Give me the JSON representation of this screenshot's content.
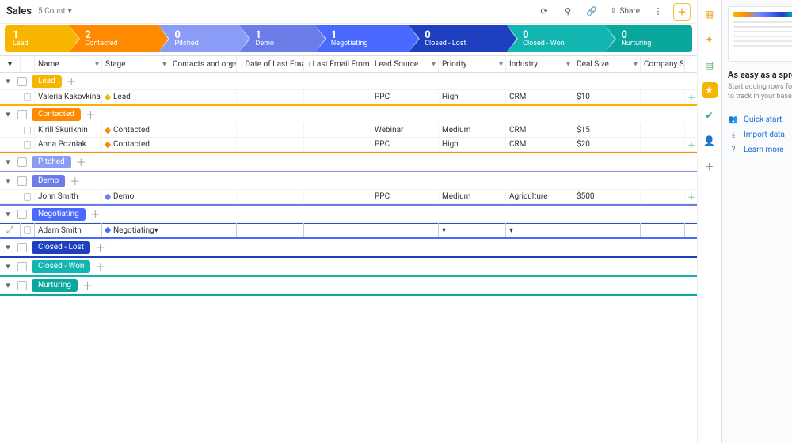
{
  "header": {
    "title": "Sales",
    "count_label": "5 Count",
    "share_label": "Share"
  },
  "funnel": [
    {
      "count": "1",
      "label": "Lead",
      "color": "#f7b500"
    },
    {
      "count": "2",
      "label": "Contacted",
      "color": "#ff8a00"
    },
    {
      "count": "0",
      "label": "Pitched",
      "color": "#8b9cf7"
    },
    {
      "count": "1",
      "label": "Demo",
      "color": "#6b7de8"
    },
    {
      "count": "1",
      "label": "Negotiating",
      "color": "#4a69ff"
    },
    {
      "count": "0",
      "label": "Closed - Lost",
      "color": "#1e3fbf"
    },
    {
      "count": "0",
      "label": "Closed - Won",
      "color": "#13b5b1"
    },
    {
      "count": "0",
      "label": "Nurturing",
      "color": "#0aa79e"
    }
  ],
  "columns": {
    "name": "Name",
    "stage": "Stage",
    "contacts": "Contacts and organizations",
    "date_email": "Date of Last Email",
    "from_email": "Last Email From",
    "lead_source": "Lead Source",
    "priority": "Priority",
    "industry": "Industry",
    "deal_size": "Deal Size",
    "company": "Company Size"
  },
  "groups": [
    {
      "id": "lead",
      "label": "Lead",
      "pill_color": "#f7b500",
      "accent": "#f7b500",
      "rows": [
        {
          "name": "Valeria Kakovkina",
          "stage": "Lead",
          "stage_color": "#f7b500",
          "source": "PPC",
          "priority": "High",
          "industry": "CRM",
          "deal": "$10"
        }
      ]
    },
    {
      "id": "contacted",
      "label": "Contacted",
      "pill_color": "#ff8a00",
      "accent": "#ff8a00",
      "rows": [
        {
          "name": "Kirill Skurikhin",
          "stage": "Contacted",
          "stage_color": "#ff8a00",
          "source": "Webinar",
          "priority": "Medium",
          "industry": "CRM",
          "deal": "$15"
        },
        {
          "name": "Anna Pozniak",
          "stage": "Contacted",
          "stage_color": "#ff8a00",
          "source": "PPC",
          "priority": "High",
          "industry": "CRM",
          "deal": "$20"
        }
      ]
    },
    {
      "id": "pitched",
      "label": "Pitched",
      "pill_color": "#8b9cf7",
      "accent": "#8b9cf7",
      "rows": []
    },
    {
      "id": "demo",
      "label": "Demo",
      "pill_color": "#6b7de8",
      "accent": "#6b7de8",
      "rows": [
        {
          "name": "John Smith",
          "stage": "Demo",
          "stage_color": "#6b7de8",
          "source": "PPC",
          "priority": "Medium",
          "industry": "Agriculture",
          "deal": "$500"
        }
      ]
    },
    {
      "id": "negotiating",
      "label": "Negotiating",
      "pill_color": "#4a69ff",
      "accent": "#4a69ff",
      "rows": [
        {
          "name": "Adam Smith",
          "stage": "Negotiating",
          "stage_color": "#4a69ff",
          "editing": true
        }
      ]
    },
    {
      "id": "closedlost",
      "label": "Closed - Lost",
      "pill_color": "#1e3fbf",
      "accent": "#1e3fbf",
      "rows": []
    },
    {
      "id": "closedwon",
      "label": "Closed - Won",
      "pill_color": "#13b5b1",
      "accent": "#13b5b1",
      "rows": []
    },
    {
      "id": "nurturing",
      "label": "Nurturing",
      "pill_color": "#0aa79e",
      "accent": "#0aa79e",
      "rows": []
    }
  ],
  "panel": {
    "heading": "As easy as a spreadsheet",
    "sub1": "Start adding rows for each item you want",
    "sub2": "to track in your base.",
    "links": {
      "quick": "Quick start",
      "import": "Import data",
      "learn": "Learn more"
    }
  }
}
